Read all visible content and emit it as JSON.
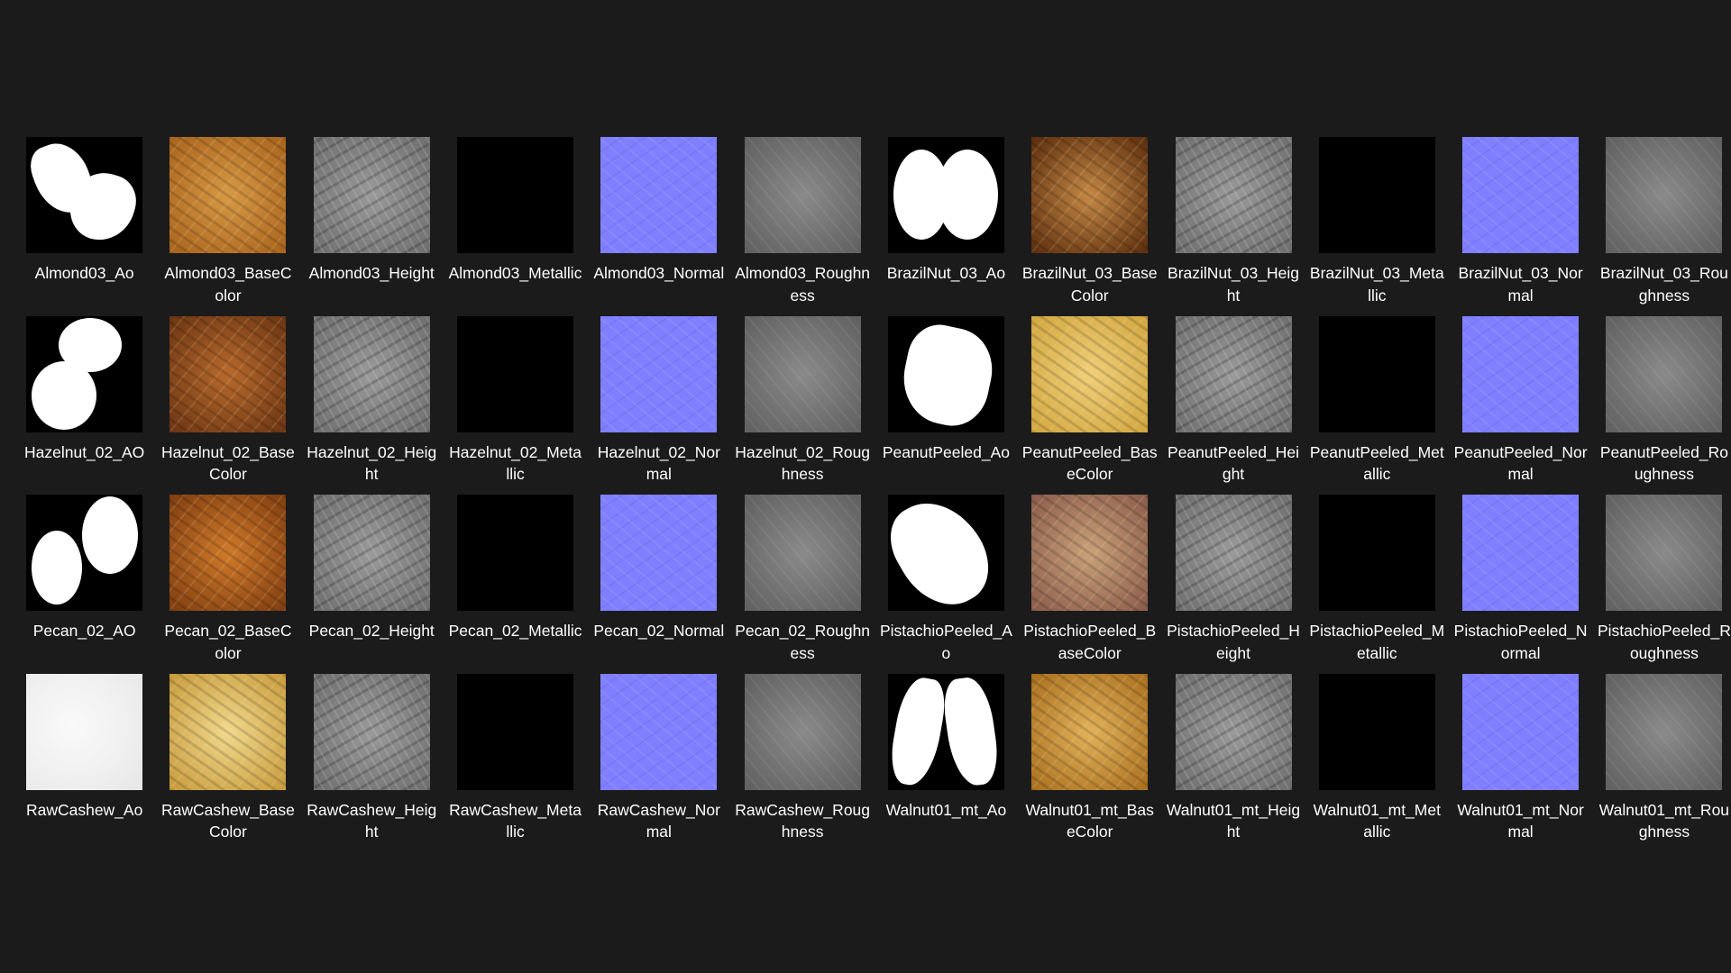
{
  "files": [
    {
      "name": "Almond03_Ao",
      "type": "ao",
      "shape": "almond"
    },
    {
      "name": "Almond03_BaseColor",
      "type": "base",
      "c1": "#a8621c",
      "c2": "#d79a45"
    },
    {
      "name": "Almond03_Height",
      "type": "height"
    },
    {
      "name": "Almond03_Metallic",
      "type": "metal"
    },
    {
      "name": "Almond03_Normal",
      "type": "normal"
    },
    {
      "name": "Almond03_Roughness",
      "type": "rough"
    },
    {
      "name": "BrazilNut_03_Ao",
      "type": "ao",
      "shape": "brazil"
    },
    {
      "name": "BrazilNut_03_BaseColor",
      "type": "base",
      "c1": "#5a2c0c",
      "c2": "#c58946"
    },
    {
      "name": "BrazilNut_03_Height",
      "type": "height"
    },
    {
      "name": "BrazilNut_03_Metallic",
      "type": "metal"
    },
    {
      "name": "BrazilNut_03_Normal",
      "type": "normal"
    },
    {
      "name": "BrazilNut_03_Roughness",
      "type": "rough"
    },
    {
      "name": "Hazelnut_02_AO",
      "type": "ao",
      "shape": "hazel"
    },
    {
      "name": "Hazelnut_02_BaseColor",
      "type": "base",
      "c1": "#6a3412",
      "c2": "#b86a2c"
    },
    {
      "name": "Hazelnut_02_Height",
      "type": "height"
    },
    {
      "name": "Hazelnut_02_Metallic",
      "type": "metal"
    },
    {
      "name": "Hazelnut_02_Normal",
      "type": "normal"
    },
    {
      "name": "Hazelnut_02_Roughness",
      "type": "rough"
    },
    {
      "name": "PeanutPeeled_Ao",
      "type": "ao",
      "shape": "peanut"
    },
    {
      "name": "PeanutPeeled_BaseColor",
      "type": "base",
      "c1": "#d2a63f",
      "c2": "#f0d07a"
    },
    {
      "name": "PeanutPeeled_Height",
      "type": "height"
    },
    {
      "name": "PeanutPeeled_Metallic",
      "type": "metal"
    },
    {
      "name": "PeanutPeeled_Normal",
      "type": "normal"
    },
    {
      "name": "PeanutPeeled_Roughness",
      "type": "rough"
    },
    {
      "name": "Pecan_02_AO",
      "type": "ao",
      "shape": "pecan"
    },
    {
      "name": "Pecan_02_BaseColor",
      "type": "base",
      "c1": "#7e3c10",
      "c2": "#d07a2a"
    },
    {
      "name": "Pecan_02_Height",
      "type": "height"
    },
    {
      "name": "Pecan_02_Metallic",
      "type": "metal"
    },
    {
      "name": "Pecan_02_Normal",
      "type": "normal"
    },
    {
      "name": "Pecan_02_Roughness",
      "type": "rough"
    },
    {
      "name": "PistachioPeeled_Ao",
      "type": "ao",
      "shape": "pistachio"
    },
    {
      "name": "PistachioPeeled_BaseColor",
      "type": "base",
      "c1": "#8a5a4a",
      "c2": "#c9a27a"
    },
    {
      "name": "PistachioPeeled_Height",
      "type": "height"
    },
    {
      "name": "PistachioPeeled_Metallic",
      "type": "metal"
    },
    {
      "name": "PistachioPeeled_Normal",
      "type": "normal"
    },
    {
      "name": "PistachioPeeled_Roughness",
      "type": "rough"
    },
    {
      "name": "RawCashew_Ao",
      "type": "ao-light"
    },
    {
      "name": "RawCashew_BaseColor",
      "type": "base",
      "c1": "#c79a3c",
      "c2": "#f1d98c"
    },
    {
      "name": "RawCashew_Height",
      "type": "height"
    },
    {
      "name": "RawCashew_Metallic",
      "type": "metal"
    },
    {
      "name": "RawCashew_Normal",
      "type": "normal"
    },
    {
      "name": "RawCashew_Roughness",
      "type": "rough"
    },
    {
      "name": "Walnut01_mt_Ao",
      "type": "ao",
      "shape": "walnut"
    },
    {
      "name": "Walnut01_mt_BaseColor",
      "type": "base",
      "c1": "#a86e1e",
      "c2": "#e2b25a"
    },
    {
      "name": "Walnut01_mt_Height",
      "type": "height"
    },
    {
      "name": "Walnut01_mt_Metallic",
      "type": "metal"
    },
    {
      "name": "Walnut01_mt_Normal",
      "type": "normal"
    },
    {
      "name": "Walnut01_mt_Roughness",
      "type": "rough"
    }
  ]
}
